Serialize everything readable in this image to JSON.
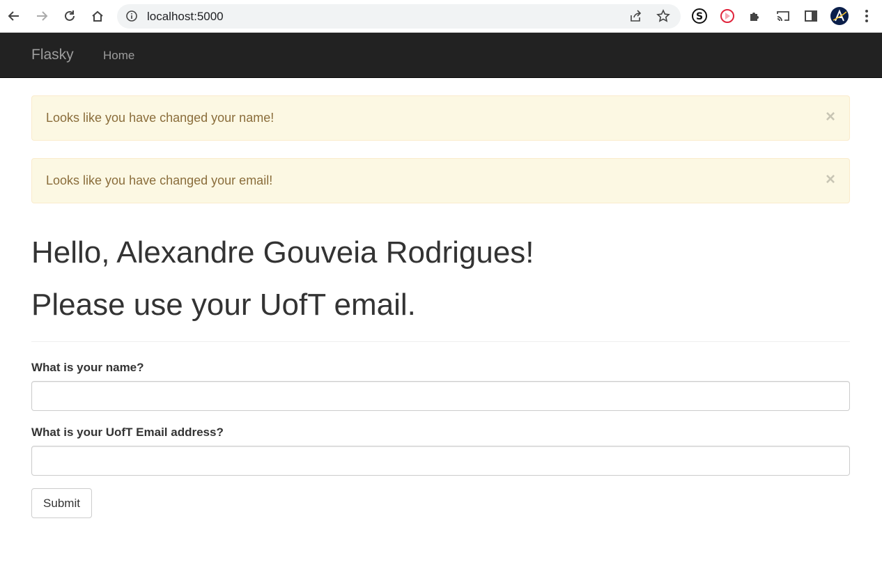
{
  "browser": {
    "url": "localhost:5000",
    "icons": {
      "back": "back-arrow-icon",
      "forward": "forward-arrow-icon",
      "reload": "reload-icon",
      "home": "home-icon",
      "info": "info-icon",
      "share": "share-icon",
      "bookmark": "star-icon",
      "extensions": "puzzle-icon",
      "cast": "cast-icon",
      "side_panel": "side-panel-icon",
      "menu": "kebab-menu-icon"
    }
  },
  "navbar": {
    "brand": "Flasky",
    "links": [
      {
        "label": "Home"
      }
    ]
  },
  "alerts": [
    {
      "message": "Looks like you have changed your name!",
      "close": "×"
    },
    {
      "message": "Looks like you have changed your email!",
      "close": "×"
    }
  ],
  "page": {
    "greeting": "Hello, Alexandre Gouveia Rodrigues!",
    "subheading": "Please use your UofT email."
  },
  "form": {
    "name_label": "What is your name?",
    "name_value": "",
    "email_label": "What is your UofT Email address?",
    "email_value": "",
    "submit_label": "Submit"
  },
  "colors": {
    "navbar_bg": "#222222",
    "navbar_text": "#9d9d9d",
    "alert_bg": "#fcf8e3",
    "alert_border": "#faebcc",
    "alert_text": "#8a6d3b"
  }
}
